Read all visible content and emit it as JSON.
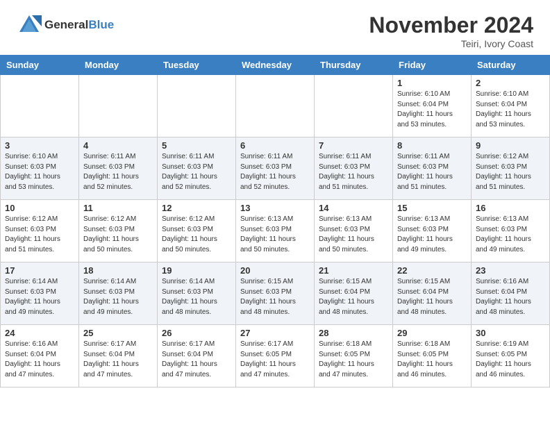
{
  "header": {
    "logo_line1": "General",
    "logo_line2": "Blue",
    "month": "November 2024",
    "location": "Teiri, Ivory Coast"
  },
  "weekdays": [
    "Sunday",
    "Monday",
    "Tuesday",
    "Wednesday",
    "Thursday",
    "Friday",
    "Saturday"
  ],
  "weeks": [
    [
      {
        "day": "",
        "info": ""
      },
      {
        "day": "",
        "info": ""
      },
      {
        "day": "",
        "info": ""
      },
      {
        "day": "",
        "info": ""
      },
      {
        "day": "",
        "info": ""
      },
      {
        "day": "1",
        "info": "Sunrise: 6:10 AM\nSunset: 6:04 PM\nDaylight: 11 hours\nand 53 minutes."
      },
      {
        "day": "2",
        "info": "Sunrise: 6:10 AM\nSunset: 6:04 PM\nDaylight: 11 hours\nand 53 minutes."
      }
    ],
    [
      {
        "day": "3",
        "info": "Sunrise: 6:10 AM\nSunset: 6:03 PM\nDaylight: 11 hours\nand 53 minutes."
      },
      {
        "day": "4",
        "info": "Sunrise: 6:11 AM\nSunset: 6:03 PM\nDaylight: 11 hours\nand 52 minutes."
      },
      {
        "day": "5",
        "info": "Sunrise: 6:11 AM\nSunset: 6:03 PM\nDaylight: 11 hours\nand 52 minutes."
      },
      {
        "day": "6",
        "info": "Sunrise: 6:11 AM\nSunset: 6:03 PM\nDaylight: 11 hours\nand 52 minutes."
      },
      {
        "day": "7",
        "info": "Sunrise: 6:11 AM\nSunset: 6:03 PM\nDaylight: 11 hours\nand 51 minutes."
      },
      {
        "day": "8",
        "info": "Sunrise: 6:11 AM\nSunset: 6:03 PM\nDaylight: 11 hours\nand 51 minutes."
      },
      {
        "day": "9",
        "info": "Sunrise: 6:12 AM\nSunset: 6:03 PM\nDaylight: 11 hours\nand 51 minutes."
      }
    ],
    [
      {
        "day": "10",
        "info": "Sunrise: 6:12 AM\nSunset: 6:03 PM\nDaylight: 11 hours\nand 51 minutes."
      },
      {
        "day": "11",
        "info": "Sunrise: 6:12 AM\nSunset: 6:03 PM\nDaylight: 11 hours\nand 50 minutes."
      },
      {
        "day": "12",
        "info": "Sunrise: 6:12 AM\nSunset: 6:03 PM\nDaylight: 11 hours\nand 50 minutes."
      },
      {
        "day": "13",
        "info": "Sunrise: 6:13 AM\nSunset: 6:03 PM\nDaylight: 11 hours\nand 50 minutes."
      },
      {
        "day": "14",
        "info": "Sunrise: 6:13 AM\nSunset: 6:03 PM\nDaylight: 11 hours\nand 50 minutes."
      },
      {
        "day": "15",
        "info": "Sunrise: 6:13 AM\nSunset: 6:03 PM\nDaylight: 11 hours\nand 49 minutes."
      },
      {
        "day": "16",
        "info": "Sunrise: 6:13 AM\nSunset: 6:03 PM\nDaylight: 11 hours\nand 49 minutes."
      }
    ],
    [
      {
        "day": "17",
        "info": "Sunrise: 6:14 AM\nSunset: 6:03 PM\nDaylight: 11 hours\nand 49 minutes."
      },
      {
        "day": "18",
        "info": "Sunrise: 6:14 AM\nSunset: 6:03 PM\nDaylight: 11 hours\nand 49 minutes."
      },
      {
        "day": "19",
        "info": "Sunrise: 6:14 AM\nSunset: 6:03 PM\nDaylight: 11 hours\nand 48 minutes."
      },
      {
        "day": "20",
        "info": "Sunrise: 6:15 AM\nSunset: 6:03 PM\nDaylight: 11 hours\nand 48 minutes."
      },
      {
        "day": "21",
        "info": "Sunrise: 6:15 AM\nSunset: 6:04 PM\nDaylight: 11 hours\nand 48 minutes."
      },
      {
        "day": "22",
        "info": "Sunrise: 6:15 AM\nSunset: 6:04 PM\nDaylight: 11 hours\nand 48 minutes."
      },
      {
        "day": "23",
        "info": "Sunrise: 6:16 AM\nSunset: 6:04 PM\nDaylight: 11 hours\nand 48 minutes."
      }
    ],
    [
      {
        "day": "24",
        "info": "Sunrise: 6:16 AM\nSunset: 6:04 PM\nDaylight: 11 hours\nand 47 minutes."
      },
      {
        "day": "25",
        "info": "Sunrise: 6:17 AM\nSunset: 6:04 PM\nDaylight: 11 hours\nand 47 minutes."
      },
      {
        "day": "26",
        "info": "Sunrise: 6:17 AM\nSunset: 6:04 PM\nDaylight: 11 hours\nand 47 minutes."
      },
      {
        "day": "27",
        "info": "Sunrise: 6:17 AM\nSunset: 6:05 PM\nDaylight: 11 hours\nand 47 minutes."
      },
      {
        "day": "28",
        "info": "Sunrise: 6:18 AM\nSunset: 6:05 PM\nDaylight: 11 hours\nand 47 minutes."
      },
      {
        "day": "29",
        "info": "Sunrise: 6:18 AM\nSunset: 6:05 PM\nDaylight: 11 hours\nand 46 minutes."
      },
      {
        "day": "30",
        "info": "Sunrise: 6:19 AM\nSunset: 6:05 PM\nDaylight: 11 hours\nand 46 minutes."
      }
    ]
  ]
}
